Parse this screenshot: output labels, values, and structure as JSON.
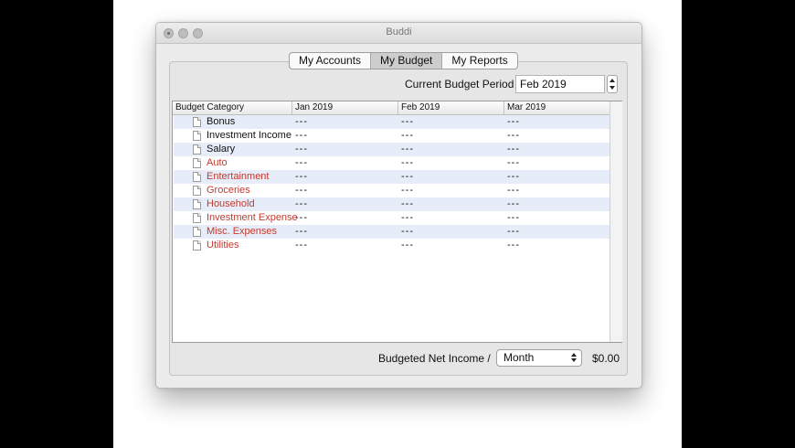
{
  "window": {
    "title": "Buddi"
  },
  "tabs": [
    {
      "label": "My Accounts",
      "active": false
    },
    {
      "label": "My Budget",
      "active": true
    },
    {
      "label": "My Reports",
      "active": false
    }
  ],
  "period": {
    "label": "Current Budget Period",
    "value": "Feb 2019"
  },
  "table": {
    "headers": [
      "Budget Category",
      "Jan 2019",
      "Feb 2019",
      "Mar 2019"
    ],
    "rows": [
      {
        "category": "Bonus",
        "type": "income",
        "values": [
          "---",
          "---",
          "---"
        ]
      },
      {
        "category": "Investment Income",
        "type": "income",
        "values": [
          "---",
          "---",
          "---"
        ]
      },
      {
        "category": "Salary",
        "type": "income",
        "values": [
          "---",
          "---",
          "---"
        ]
      },
      {
        "category": "Auto",
        "type": "expense",
        "values": [
          "---",
          "---",
          "---"
        ]
      },
      {
        "category": "Entertainment",
        "type": "expense",
        "values": [
          "---",
          "---",
          "---"
        ]
      },
      {
        "category": "Groceries",
        "type": "expense",
        "values": [
          "---",
          "---",
          "---"
        ]
      },
      {
        "category": "Household",
        "type": "expense",
        "values": [
          "---",
          "---",
          "---"
        ]
      },
      {
        "category": "Investment Expense",
        "type": "expense",
        "values": [
          "---",
          "---",
          "---"
        ]
      },
      {
        "category": "Misc. Expenses",
        "type": "expense",
        "values": [
          "---",
          "---",
          "---"
        ]
      },
      {
        "category": "Utilities",
        "type": "expense",
        "values": [
          "---",
          "---",
          "---"
        ]
      }
    ]
  },
  "footer": {
    "net_label": "Budgeted Net Income /",
    "period_select": "Month",
    "net_value": "$0.00"
  },
  "colors": {
    "expense": "#c23a2e",
    "row_stripe": "#e6edf8"
  },
  "icons": {
    "row_icon": "document-icon"
  }
}
